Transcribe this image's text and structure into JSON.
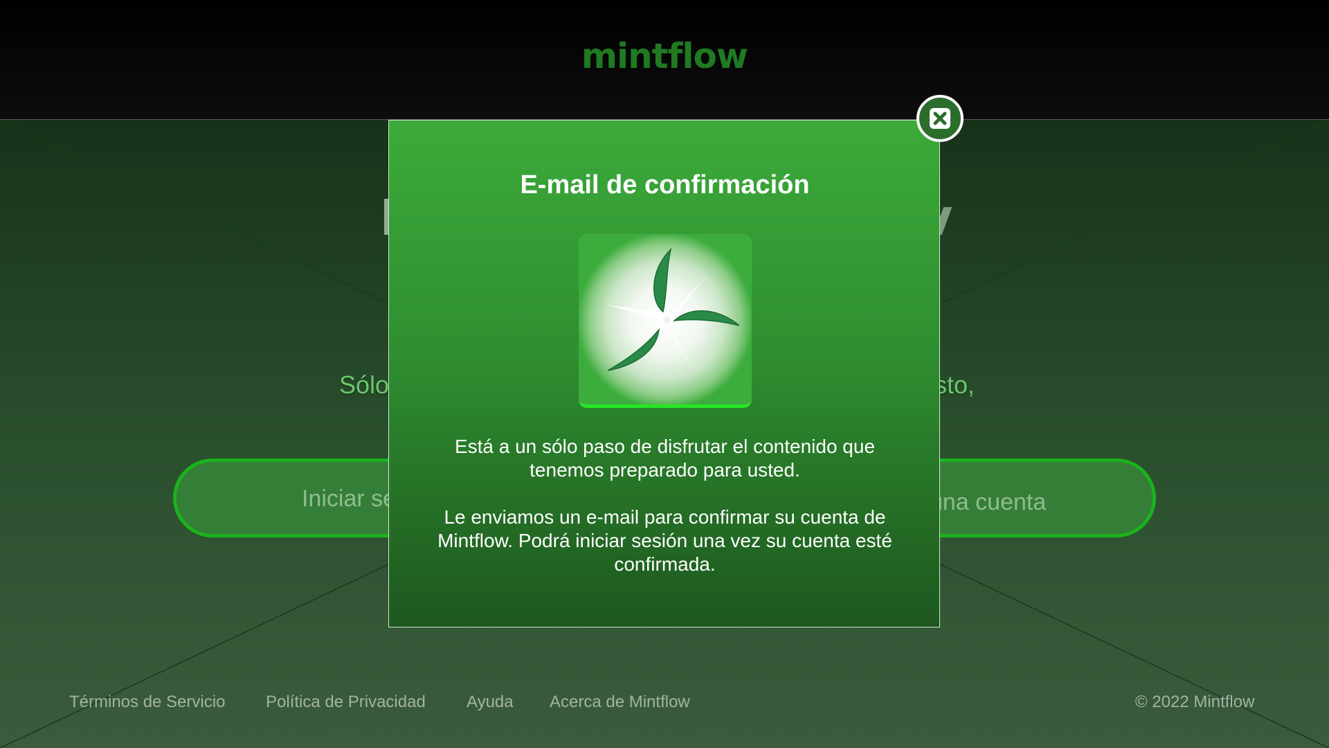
{
  "header": {
    "logo_text": "mintflow"
  },
  "background": {
    "fragment_left": "Sólo",
    "fragment_right": "osto,",
    "login_button_fragment": "Iniciar se",
    "create_button_fragment": "una cuenta"
  },
  "modal": {
    "title": "E-mail de confirmación",
    "icon": "mintflow-pinwheel-icon",
    "paragraph1": "Está a un sólo paso de disfrutar el contenido que tenemos preparado para usted.",
    "paragraph2": "Le enviamos un e-mail para confirmar su cuenta de Mintflow. Podrá iniciar sesión una vez su cuenta esté confirmada.",
    "close_icon": "close-icon"
  },
  "footer": {
    "links": [
      "Términos de Servicio",
      "Política de Privacidad",
      "Ayuda",
      "Acerca de Mintflow"
    ],
    "copyright": "© 2022 Mintflow"
  },
  "colors": {
    "accent": "#3caa3a",
    "pill_border": "#1bb21d",
    "logo": "#1f7a22"
  }
}
